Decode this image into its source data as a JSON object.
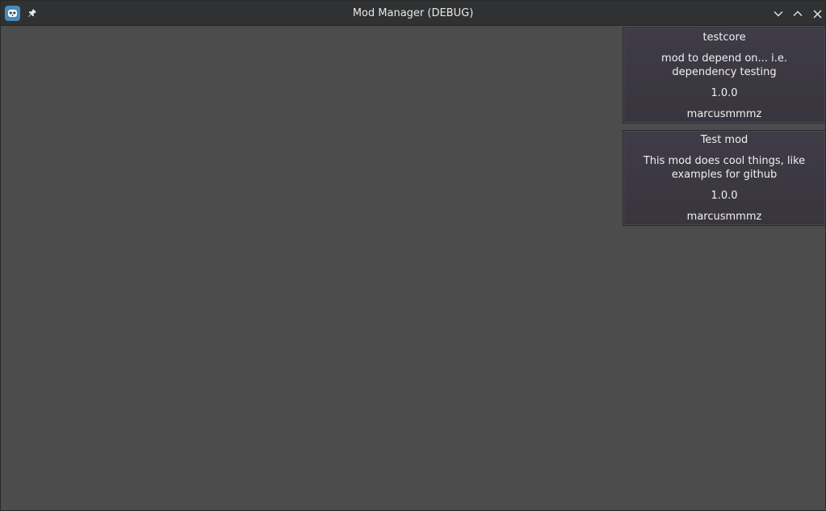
{
  "window": {
    "title": "Mod Manager (DEBUG)",
    "icons": {
      "app": "godot-icon",
      "pin": "pin-icon",
      "minimize": "chevron-down-icon",
      "maximize": "chevron-up-icon",
      "close": "close-icon"
    }
  },
  "mods": [
    {
      "name": "testcore",
      "description": "mod to depend on... i.e. dependency testing",
      "version": "1.0.0",
      "author": "marcusmmmz"
    },
    {
      "name": "Test mod",
      "description": "This mod does cool things, like examples for github",
      "version": "1.0.0",
      "author": "marcusmmmz"
    }
  ],
  "colors": {
    "background": "#4c4c4c",
    "titlebar": "#2f3133",
    "card": "#3d3a44",
    "text": "#f0f0f0"
  }
}
